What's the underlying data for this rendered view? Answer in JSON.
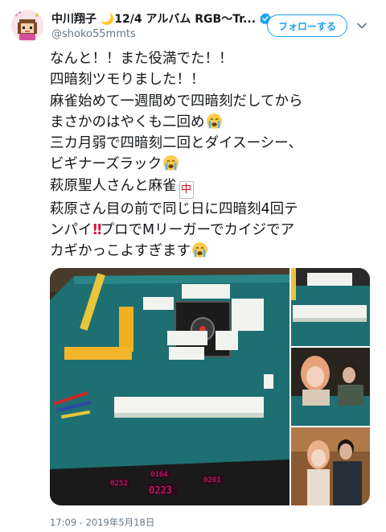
{
  "user": {
    "display_name": "中川翔子 🌙12/4 アルバム RGB〜Tr...",
    "handle": "@shoko55mmts",
    "follow_label": "フォローする"
  },
  "tweet": {
    "lines": [
      "なんと！！また役満でた！！",
      "四暗刻ツモりました！！",
      "麻雀始めて一週間めで四暗刻だしてから",
      "まさかのはやくも二回め",
      "三カ月弱で四暗刻二回とダイスーシー、",
      "ビギナーズラック",
      "萩原聖人さんと麻雀",
      "萩原さん目の前で同じ日に四暗刻4回テ",
      "ンパイ",
      "プロでMリーガーでカイジでア",
      "カギかっこよすぎます"
    ],
    "chun_tile": "中",
    "timestamp": "17:09 - 2019年5月18日"
  },
  "media": {
    "score_display": [
      "0252",
      "0164",
      "0223",
      "0201"
    ]
  },
  "icons": {
    "verified": "verified-badge-icon",
    "chevron": "chevron-down-icon",
    "emoji_cry": "loudly-crying-face-icon",
    "emoji_bangbang": "double-exclamation-icon",
    "chun": "mahjong-red-dragon-icon"
  },
  "colors": {
    "accent": "#1da1f2",
    "text": "#14171a",
    "secondary": "#657786",
    "mat": "#1e6f72",
    "led": "#e0207a"
  }
}
